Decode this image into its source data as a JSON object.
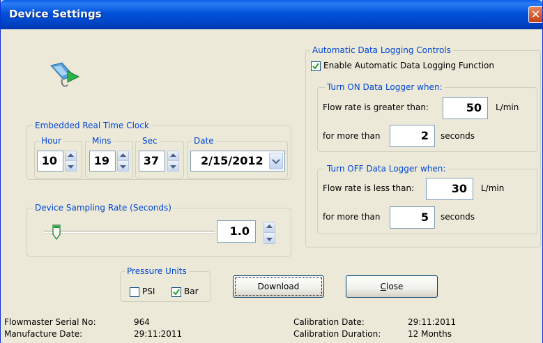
{
  "window": {
    "title": "Device Settings",
    "close_glyph": "✕"
  },
  "rtc": {
    "legend": "Embedded Real Time Clock",
    "hour": {
      "label": "Hour",
      "value": "10"
    },
    "mins": {
      "label": "Mins",
      "value": "19"
    },
    "sec": {
      "label": "Sec",
      "value": "37"
    },
    "date": {
      "label": "Date",
      "value": "2/15/2012"
    }
  },
  "sampling": {
    "legend": "Device Sampling Rate (Seconds)",
    "value": "1.0",
    "slider_fraction": 0.08
  },
  "pressure": {
    "legend": "Pressure Units",
    "psi_label": "PSI",
    "psi_checked": false,
    "bar_label": "Bar",
    "bar_checked": true
  },
  "buttons": {
    "download": "Download",
    "close_prefix": "C",
    "close_rest": "lose"
  },
  "logging": {
    "legend": "Automatic Data Logging Controls",
    "enable_label": "Enable Automatic Data Logging Function",
    "enable_checked": true,
    "on": {
      "legend": "Turn ON Data Logger when:",
      "flow_label": "Flow rate is greater than:",
      "flow_value": "50",
      "flow_unit": "L/min",
      "time_label": "for more than",
      "time_value": "2",
      "time_unit": "seconds"
    },
    "off": {
      "legend": "Turn OFF Data Logger when:",
      "flow_label": "Flow rate is less than:",
      "flow_value": "30",
      "flow_unit": "L/min",
      "time_label": "for more than",
      "time_value": "5",
      "time_unit": "seconds"
    }
  },
  "footer": {
    "serial_label": "Flowmaster Serial No:",
    "serial_value": "964",
    "mfg_label": "Manufacture Date:",
    "mfg_value": "29:11:2011",
    "cal_date_label": "Calibration Date:",
    "cal_date_value": "29:11:2011",
    "cal_dur_label": "Calibration Duration:",
    "cal_dur_value": "12 Months"
  },
  "icons": {
    "device_icon": "usb-device-icon"
  }
}
